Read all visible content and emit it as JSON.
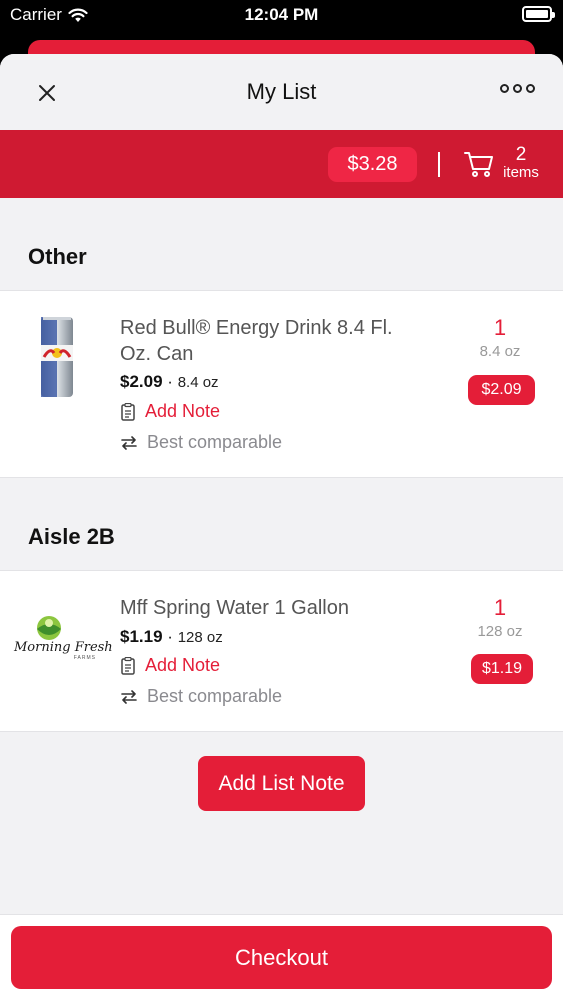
{
  "status_bar": {
    "carrier": "Carrier",
    "time": "12:04 PM"
  },
  "nav": {
    "title": "My List",
    "close_icon": "close-icon",
    "more_icon": "more-icon"
  },
  "summary": {
    "total": "$3.28",
    "item_count": "2",
    "items_label": "items"
  },
  "sections": [
    {
      "title": "Other",
      "items": [
        {
          "name": "Red Bull® Energy Drink 8.4 Fl. Oz. Can",
          "price": "$2.09",
          "separator": "·",
          "size": "8.4 oz",
          "note_label": "Add Note",
          "comparable_label": "Best comparable",
          "quantity": "1",
          "quantity_size": "8.4 oz",
          "line_price": "$2.09"
        }
      ]
    },
    {
      "title": "Aisle 2B",
      "items": [
        {
          "name": "Mff Spring Water 1 Gallon",
          "price": "$1.19",
          "separator": "·",
          "size": "128 oz",
          "note_label": "Add Note",
          "comparable_label": "Best comparable",
          "quantity": "1",
          "quantity_size": "128 oz",
          "line_price": "$1.19",
          "logo_text": "Morning Fresh",
          "logo_subtext": "FARMS"
        }
      ]
    }
  ],
  "add_list_note": "Add List Note",
  "checkout": "Checkout",
  "colors": {
    "accent": "#e41e38",
    "bar": "#cf1a32",
    "background": "#f2f2f4"
  }
}
